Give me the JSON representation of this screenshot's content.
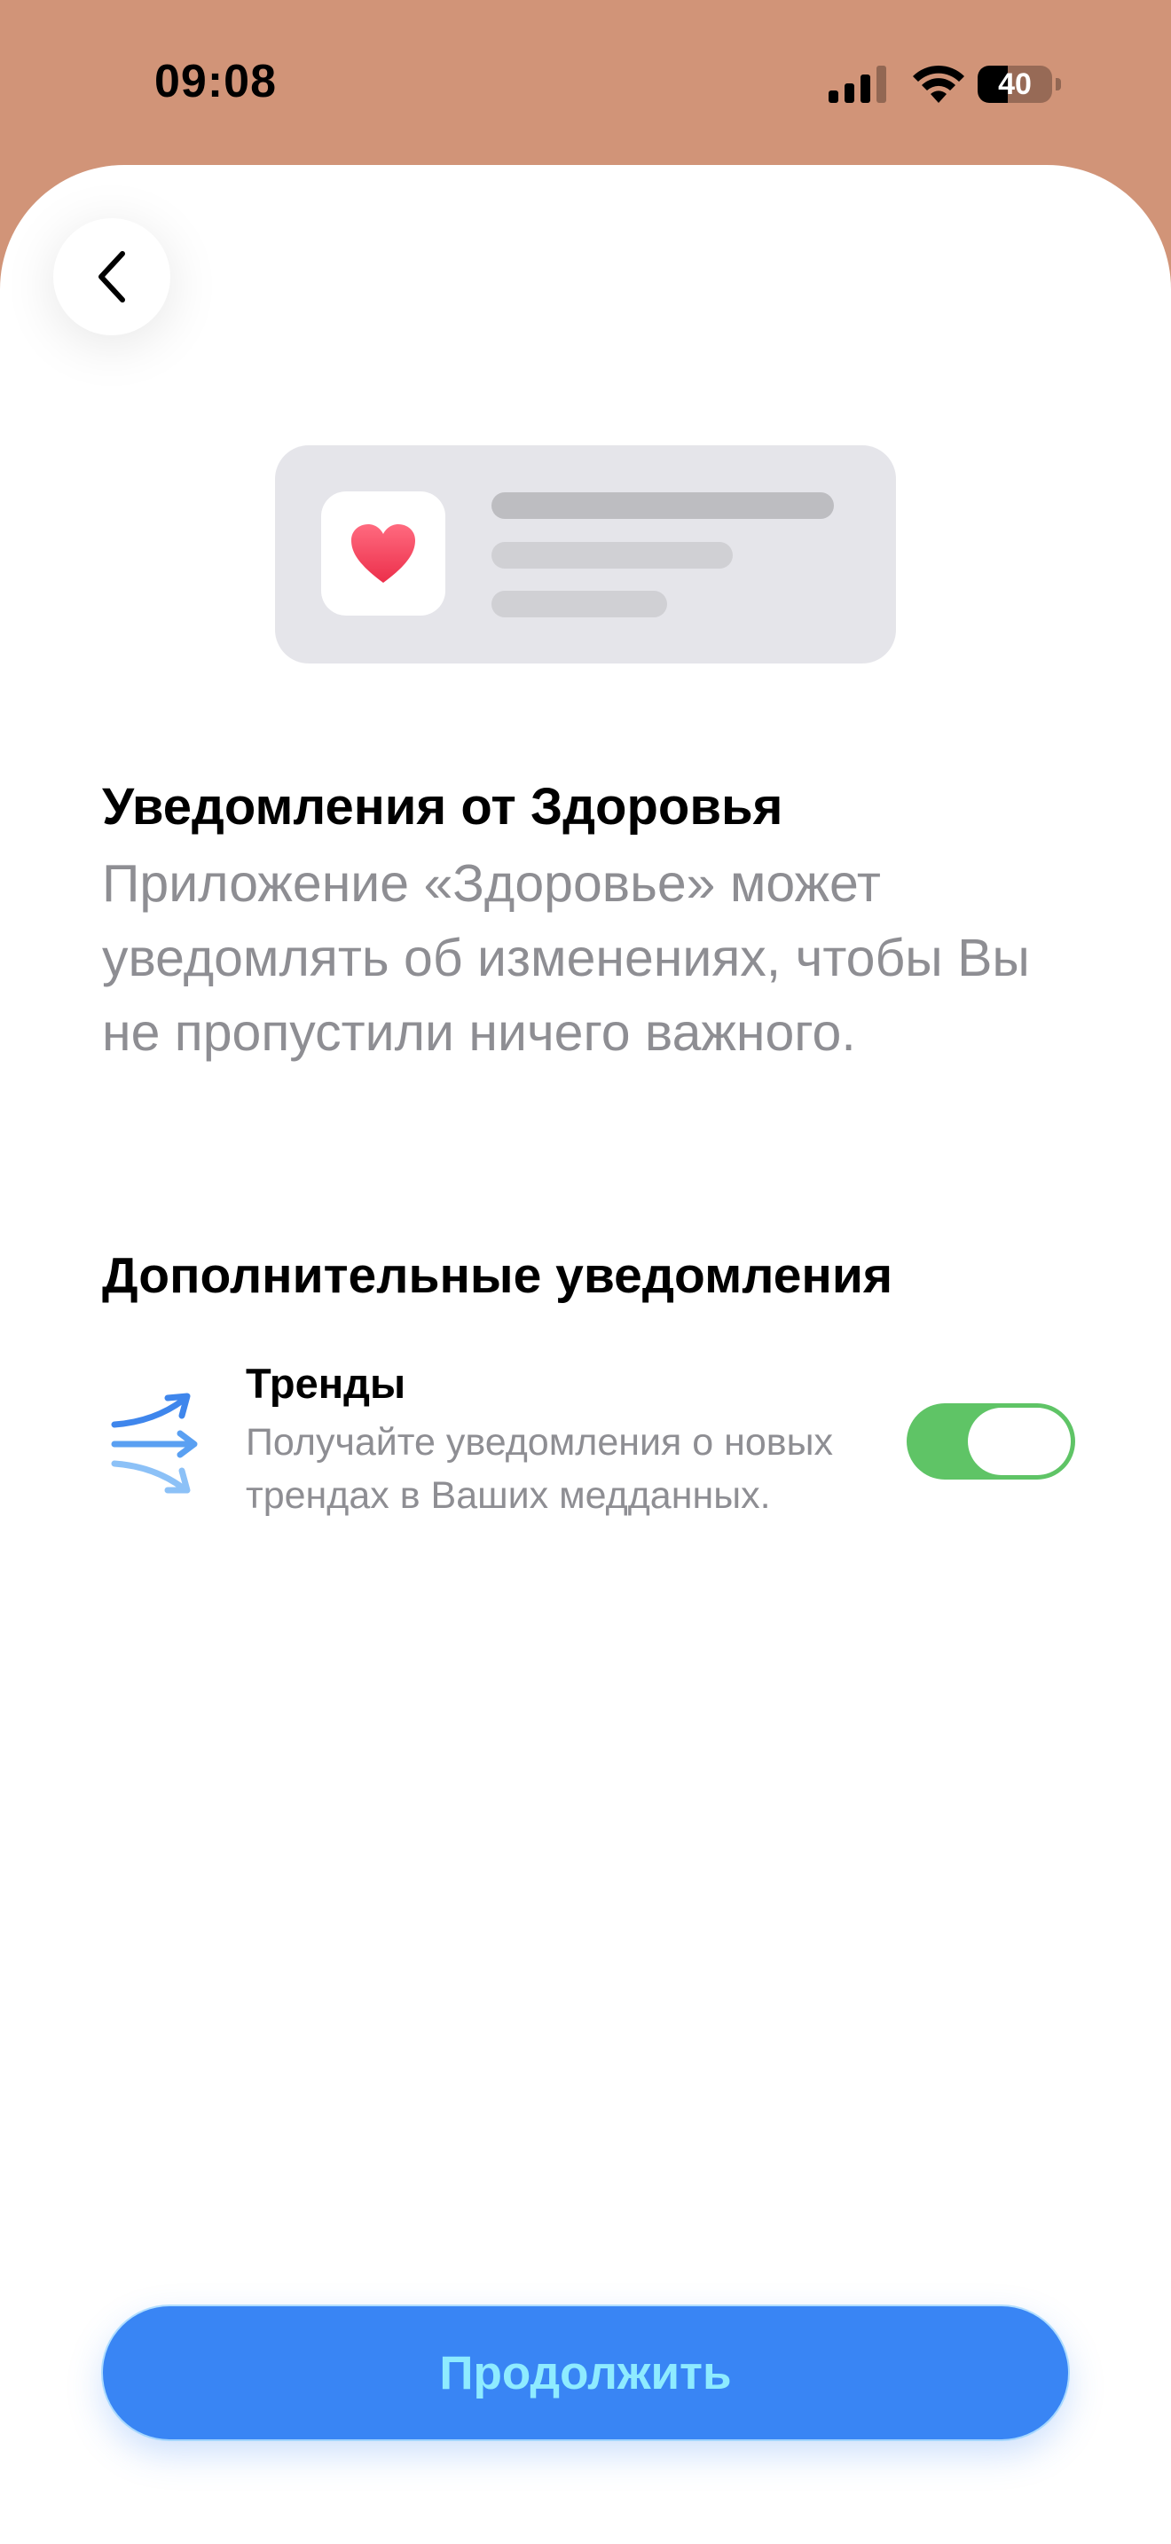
{
  "status_bar": {
    "time": "09:08",
    "battery_level": "40",
    "battery_percent": 40,
    "cell_signal_icon": "cellular-signal-icon",
    "wifi_icon": "wifi-icon",
    "battery_icon": "battery-icon"
  },
  "navigation": {
    "back_icon": "chevron-left-icon"
  },
  "illustration": {
    "app_icon": "heart-icon",
    "heart_color": "#F0465E"
  },
  "content": {
    "headline": "Уведомления от Здоровья",
    "description": "Приложение «Здоровье» может уведомлять об изменениях, чтобы Вы не пропустили ничего важного."
  },
  "additional": {
    "section_title": "Дополнительные уведомления",
    "trends": {
      "icon": "trends-arrows-icon",
      "title": "Тренды",
      "description": "Получайте уведомления о новых трендах в Ваших медданных.",
      "enabled": true
    }
  },
  "footer": {
    "continue_label": "Продолжить"
  },
  "colors": {
    "background": "#D19478",
    "toggle_on": "#5FC466",
    "primary_button": "#3985F4"
  }
}
